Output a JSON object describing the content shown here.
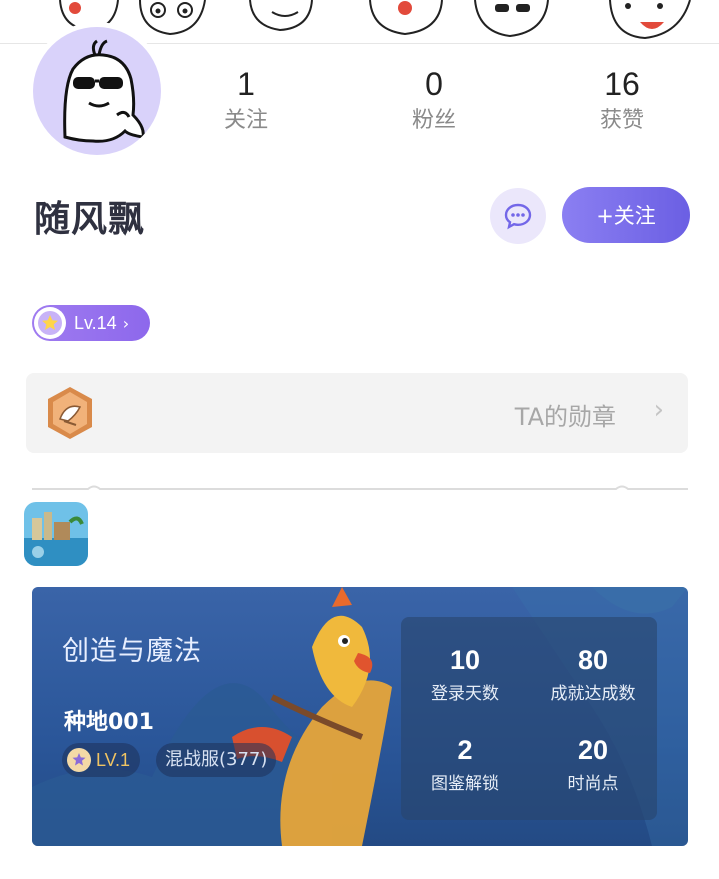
{
  "profile": {
    "username": "随风飘",
    "stats": [
      {
        "value": "1",
        "label": "关注"
      },
      {
        "value": "0",
        "label": "粉丝"
      },
      {
        "value": "16",
        "label": "获赞"
      }
    ],
    "follow_label": "+关注",
    "level": "Lv.14"
  },
  "medal": {
    "label": "TA的勋章"
  },
  "game_card": {
    "title": "创造与魔法",
    "role_name": "种地001",
    "role_level": "LV.1",
    "server": "混战服(377)",
    "stats": [
      {
        "value": "10",
        "label": "登录天数"
      },
      {
        "value": "80",
        "label": "成就达成数"
      },
      {
        "value": "2",
        "label": "图鉴解锁"
      },
      {
        "value": "20",
        "label": "时尚点"
      }
    ]
  },
  "colors": {
    "accent": "#7367e8",
    "level_badge": "#9a74ef",
    "card_bg": "#2a5699"
  },
  "icons": [
    "chat-bubble-icon",
    "star-icon",
    "chevron-right-icon",
    "medal-icon",
    "game-app-icon"
  ]
}
